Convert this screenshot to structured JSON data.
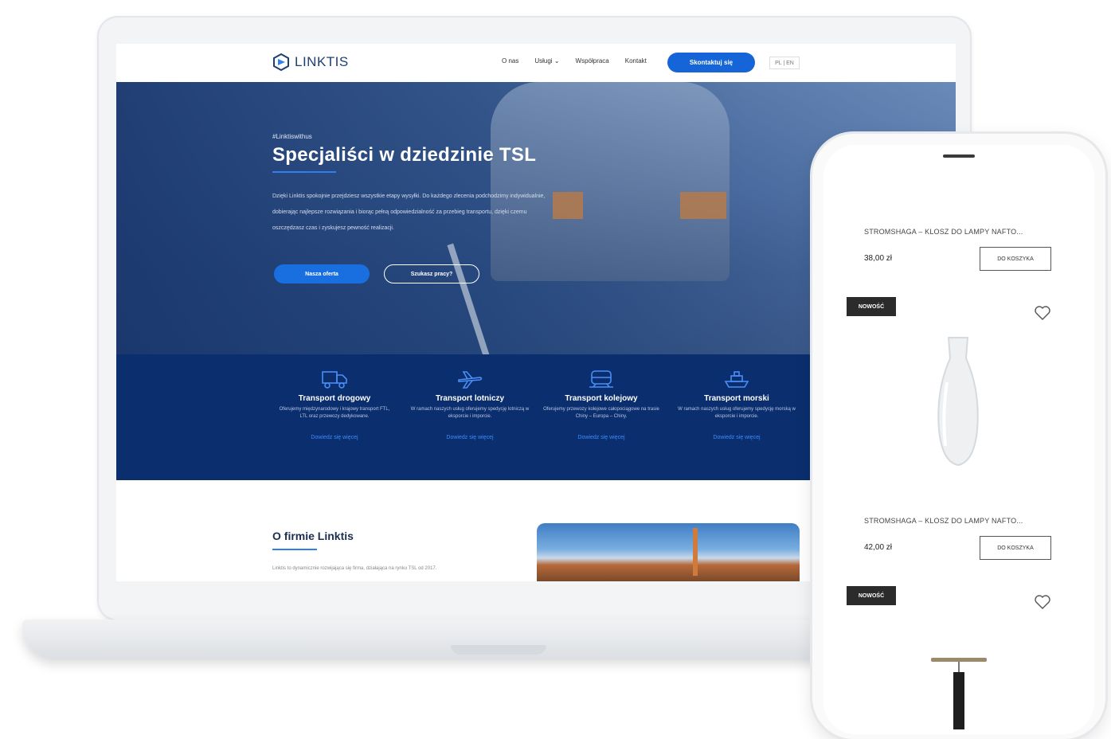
{
  "site": {
    "logo_text": "LINKTIS",
    "nav": [
      "O nas",
      "Usługi",
      "Współpraca",
      "Kontakt"
    ],
    "cta": "Skontaktuj się",
    "lang": "PL | EN"
  },
  "hero": {
    "tag": "#Linktiswithus",
    "title": "Specjaliści w dziedzinie TSL",
    "text": "Dzięki Linktis spokojnie przejdziesz wszystkie etapy wysyłki. Do każdego zlecenia podchodzimy indywidualnie, dobierając najlepsze rozwiązania i biorąc pełną odpowiedzialność za przebieg transportu, dzięki czemu oszczędzasz czas i zyskujesz pewność realizacji.",
    "btn_primary": "Nasza oferta",
    "btn_secondary": "Szukasz pracy?"
  },
  "services": [
    {
      "title": "Transport drogowy",
      "desc": "Oferujemy międzynarodowy i krajowy transport FTL, LTL oraz przewozy dedykowane.",
      "link": "Dowiedz się więcej",
      "icon": "truck-icon"
    },
    {
      "title": "Transport lotniczy",
      "desc": "W ramach naszych usług oferujemy spedycję lotniczą w eksporcie i imporcie.",
      "link": "Dowiedz się więcej",
      "icon": "plane-icon"
    },
    {
      "title": "Transport kolejowy",
      "desc": "Oferujemy przewozy kolejowe całopociągowe na trasie Chiny – Europa – Chiny.",
      "link": "Dowiedz się więcej",
      "icon": "train-icon"
    },
    {
      "title": "Transport morski",
      "desc": "W ramach naszych usług oferujemy spedycję morską w eksporcie i imporcie.",
      "link": "Dowiedz się więcej",
      "icon": "ship-icon"
    }
  ],
  "about": {
    "title": "O firmie Linktis",
    "text": "Linktis to dynamicznie rozwijająca się firma, działająca na rynku TSL od 2017."
  },
  "shop": {
    "products": [
      {
        "name": "STROMSHAGA – KLOSZ DO LAMPY NAFTO...",
        "price": "38,00 zł",
        "button": "DO KOSZYKA"
      },
      {
        "name": "STROMSHAGA – KLOSZ DO LAMPY NAFTO...",
        "price": "42,00 zł",
        "button": "DO KOSZYKA"
      }
    ],
    "badges": [
      "NOWOŚĆ",
      "NOWOŚĆ"
    ]
  },
  "colors": {
    "brand_blue": "#1565d8",
    "navy": "#0b2e6e",
    "badge": "#2b2b2b"
  }
}
